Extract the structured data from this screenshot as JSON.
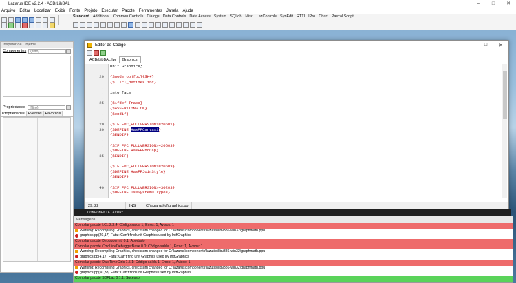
{
  "ide": {
    "title": "Lazarus IDE v2.2.4 - ACBrLibBAL",
    "menu": [
      "Arquivo",
      "Editar",
      "Localizar",
      "Exibir",
      "Fonte",
      "Projeto",
      "Executar",
      "Pacote",
      "Ferramentas",
      "Janela",
      "Ajuda"
    ],
    "palette_tabs": [
      "Standard",
      "Additional",
      "Common Controls",
      "Dialogs",
      "Data Controls",
      "Data Access",
      "System",
      "SQLdb",
      "Misc",
      "LazControls",
      "SynEdit",
      "RTTI",
      "IPro",
      "Chart",
      "Pascal Script"
    ]
  },
  "inspector": {
    "title": "Inspetor de Objetos",
    "components_label": "Componentes",
    "filter_placeholder": "(filtro)",
    "properties_label": "Propriedades",
    "tabs": [
      "Propriedades",
      "Eventos",
      "Favoritos"
    ]
  },
  "editor": {
    "title": "Editor de Código",
    "tabs": [
      "ACBrLibBAL.lpr",
      "Graphics"
    ],
    "active_tab": "Graphics",
    "gutter": [
      ".",
      ".",
      "20",
      ".",
      ".",
      ".",
      ".",
      "25",
      ".",
      ".",
      ".",
      "29",
      "30",
      ".",
      ".",
      ".",
      ".",
      "35",
      ".",
      ".",
      ".",
      ".",
      ".",
      "40",
      "."
    ],
    "status": {
      "position": "29: 22",
      "mode": "INS",
      "file": "C:\\lazarus\\lcl\\graphics.pp"
    }
  },
  "code_lines": [
    {
      "text": "unit Graphics;",
      "kind": "kw"
    },
    {
      "text": "",
      "kind": "kw"
    },
    {
      "text": "{$mode objfpc}{$H+}",
      "kind": "dir"
    },
    {
      "text": "{$I lcl_defines.inc}",
      "kind": "dir"
    },
    {
      "text": "",
      "kind": "kw"
    },
    {
      "text": "interface",
      "kind": "kw"
    },
    {
      "text": "",
      "kind": "kw"
    },
    {
      "text": "{$ifdef Trace}",
      "kind": "dir"
    },
    {
      "text": "{$ASSERTIONS ON}",
      "kind": "dir"
    },
    {
      "text": "{$endif}",
      "kind": "dir"
    },
    {
      "text": "",
      "kind": "kw"
    },
    {
      "text": "{$IF FPC_FULLVERSION>=20601}",
      "kind": "dir"
    },
    {
      "text": "{$DEFINE ",
      "kind": "dir",
      "sel": "HasFPCanvas1",
      "after": "}"
    },
    {
      "text": "{$ENDIF}",
      "kind": "dir"
    },
    {
      "text": "",
      "kind": "kw"
    },
    {
      "text": "{$IF FPC_FULLVERSION>=20603}",
      "kind": "dir"
    },
    {
      "text": "{$DEFINE HasFPEndCap}",
      "kind": "dir"
    },
    {
      "text": "{$ENDIF}",
      "kind": "dir"
    },
    {
      "text": "",
      "kind": "kw"
    },
    {
      "text": "{$IF FPC_FULLVERSION>=20603}",
      "kind": "dir"
    },
    {
      "text": "{$DEFINE HasFPJoinStyle}",
      "kind": "dir"
    },
    {
      "text": "{$ENDIF}",
      "kind": "dir"
    },
    {
      "text": "",
      "kind": "kw"
    },
    {
      "text": "{$IF FPC_FULLVERSION>=30203}",
      "kind": "dir"
    },
    {
      "text": "{$DEFINE UseSystemUITypes}",
      "kind": "dir"
    }
  ],
  "console_text": "COMPONENTE ACBR:",
  "messages": {
    "title": "Mensagens",
    "items": [
      {
        "type": "err",
        "text": "Compilar pacote LCL 2.2.4: Código saída 1, Erros: 1, Avisos: 1"
      },
      {
        "type": "warn",
        "text": "Warning: Recompiling Graphics, checksum changed for C:\\lazarus\\components\\lazutils\\lib\\i386-win32\\graphmath.ppu"
      },
      {
        "type": "fatal",
        "text": "graphics.pp(29,17) Fatal: Can't find unit Graphics used by IntfGraphics"
      },
      {
        "type": "err",
        "text": "Compilar pacote DebuggerIntf 0.1: Abortado"
      },
      {
        "type": "err",
        "text": "Compilar pacote CmdLineDebuggerBase 0.0: Código saída 1, Erros: 1, Avisos: 1"
      },
      {
        "type": "warn",
        "text": "Warning: Recompiling Graphics, checksum changed for C:\\lazarus\\components\\lazutils\\lib\\i386-win32\\graphmath.ppu"
      },
      {
        "type": "fatal",
        "text": "graphics.pp(4,17) Fatal: Can't find unit Graphics used by IntfGraphics"
      },
      {
        "type": "err",
        "text": "Compilar pacote DateTimeCtrls 1.5.1: Código saída 1, Erros: 1, Avisos: 1"
      },
      {
        "type": "warn",
        "text": "Warning: Recompiling Graphics, checksum changed for C:\\lazarus\\components\\lazutils\\lib\\i386-win32\\graphmath.ppu"
      },
      {
        "type": "fatal",
        "text": "graphics.pp(50,38) Fatal: Can't find unit Graphics used by IntfGraphics"
      },
      {
        "type": "ok",
        "text": "Compilar pacote SDFLaz 0.1.1: Sucesso"
      }
    ]
  }
}
